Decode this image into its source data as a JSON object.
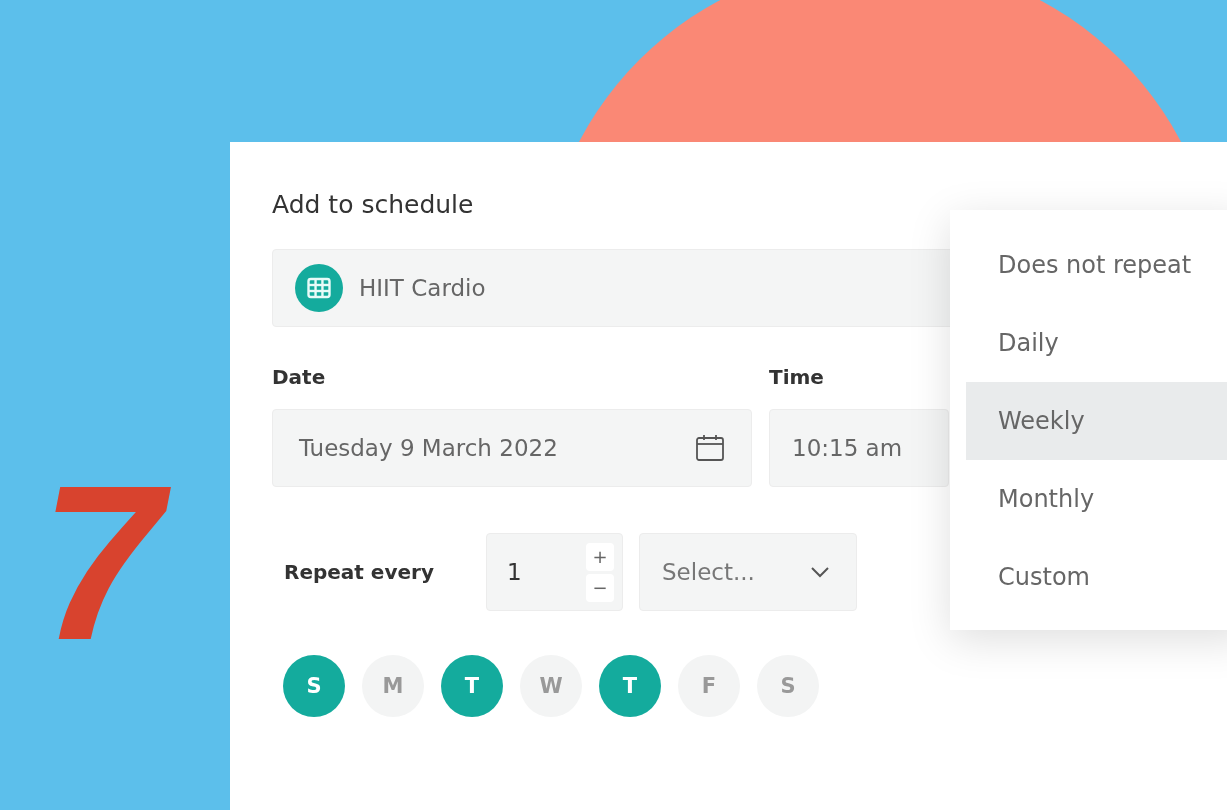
{
  "step_number": "7",
  "title": "Add to schedule",
  "workout": {
    "value": "HIIT Cardio"
  },
  "date": {
    "label": "Date",
    "value": "Tuesday 9 March 2022"
  },
  "time": {
    "label": "Time",
    "value": "10:15 am"
  },
  "repeat": {
    "label": "Repeat every",
    "count": "1",
    "plus": "+",
    "minus": "−",
    "unit_placeholder": "Select..."
  },
  "days": [
    {
      "label": "S",
      "selected": true
    },
    {
      "label": "M",
      "selected": false
    },
    {
      "label": "T",
      "selected": true
    },
    {
      "label": "W",
      "selected": false
    },
    {
      "label": "T",
      "selected": true
    },
    {
      "label": "F",
      "selected": false
    },
    {
      "label": "S",
      "selected": false
    }
  ],
  "repeat_menu": [
    {
      "label": "Does not repeat",
      "selected": false
    },
    {
      "label": "Daily",
      "selected": false
    },
    {
      "label": "Weekly",
      "selected": true
    },
    {
      "label": "Monthly",
      "selected": false
    },
    {
      "label": "Custom",
      "selected": false
    }
  ]
}
